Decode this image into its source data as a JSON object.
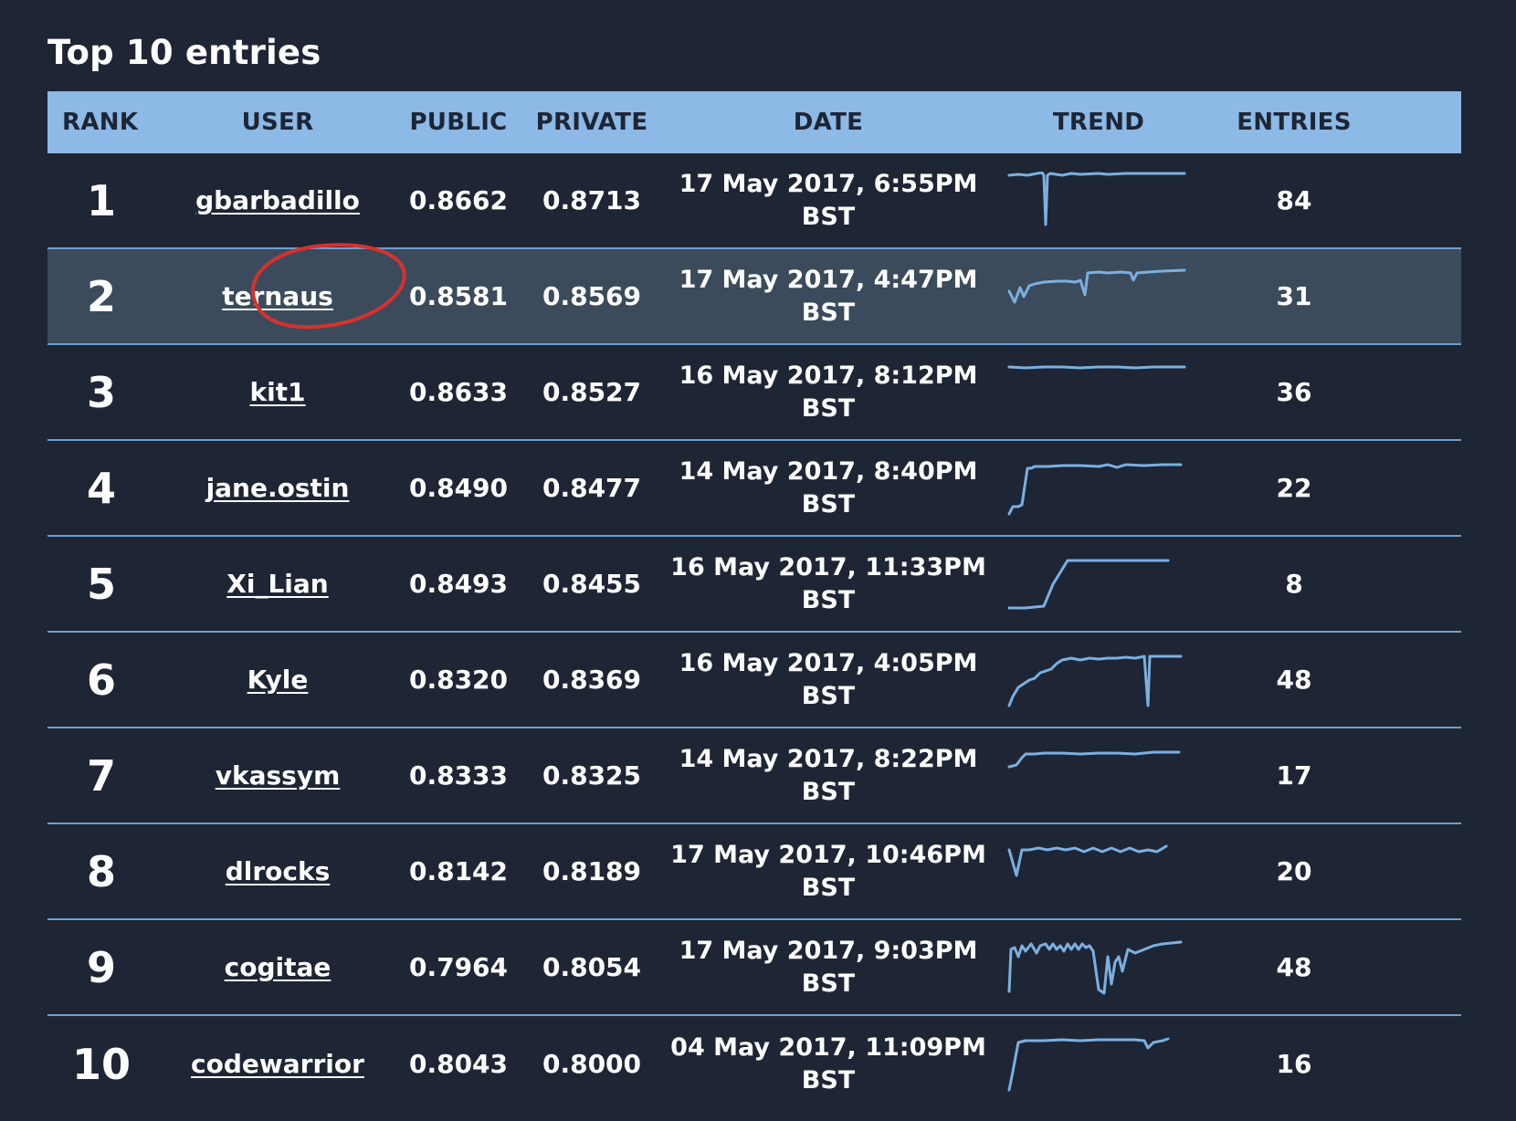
{
  "title": "Top 10 entries",
  "accent_colors": {
    "background": "#1e2535",
    "header": "#8cb9e6",
    "highlight_row": "#3b4b5b",
    "trend_line": "#7bb0e0",
    "annotation": "#d8312b"
  },
  "columns": {
    "rank": "RANK",
    "user": "USER",
    "public": "PUBLIC",
    "private": "PRIVATE",
    "date": "DATE",
    "trend": "TREND",
    "entries": "ENTRIES"
  },
  "rows": [
    {
      "rank": "1",
      "user": "gbarbadillo",
      "public": "0.8662",
      "private": "0.8713",
      "date_line1": "17 May 2017, 6:55PM",
      "date_line2": "BST",
      "entries": "84",
      "highlighted": false
    },
    {
      "rank": "2",
      "user": "ternaus",
      "public": "0.8581",
      "private": "0.8569",
      "date_line1": "17 May 2017, 4:47PM",
      "date_line2": "BST",
      "entries": "31",
      "highlighted": true
    },
    {
      "rank": "3",
      "user": "kit1",
      "public": "0.8633",
      "private": "0.8527",
      "date_line1": "16 May 2017, 8:12PM",
      "date_line2": "BST",
      "entries": "36",
      "highlighted": false
    },
    {
      "rank": "4",
      "user": "jane.ostin",
      "public": "0.8490",
      "private": "0.8477",
      "date_line1": "14 May 2017, 8:40PM",
      "date_line2": "BST",
      "entries": "22",
      "highlighted": false
    },
    {
      "rank": "5",
      "user": "Xi_Lian",
      "public": "0.8493",
      "private": "0.8455",
      "date_line1": "16 May 2017, 11:33PM",
      "date_line2": "BST",
      "entries": "8",
      "highlighted": false
    },
    {
      "rank": "6",
      "user": "Kyle",
      "public": "0.8320",
      "private": "0.8369",
      "date_line1": "16 May 2017, 4:05PM",
      "date_line2": "BST",
      "entries": "48",
      "highlighted": false
    },
    {
      "rank": "7",
      "user": "vkassym",
      "public": "0.8333",
      "private": "0.8325",
      "date_line1": "14 May 2017, 8:22PM",
      "date_line2": "BST",
      "entries": "17",
      "highlighted": false
    },
    {
      "rank": "8",
      "user": "dlrocks",
      "public": "0.8142",
      "private": "0.8189",
      "date_line1": "17 May 2017, 10:46PM",
      "date_line2": "BST",
      "entries": "20",
      "highlighted": false
    },
    {
      "rank": "9",
      "user": "cogitae",
      "public": "0.7964",
      "private": "0.8054",
      "date_line1": "17 May 2017, 9:03PM",
      "date_line2": "BST",
      "entries": "48",
      "highlighted": false
    },
    {
      "rank": "10",
      "user": "codewarrior",
      "public": "0.8043",
      "private": "0.8000",
      "date_line1": "04 May 2017, 11:09PM",
      "date_line2": "BST",
      "entries": "16",
      "highlighted": false
    }
  ]
}
